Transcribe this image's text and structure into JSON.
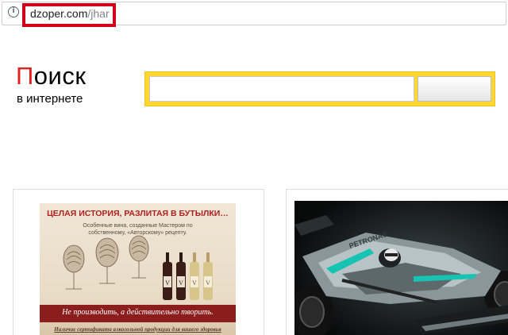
{
  "browser": {
    "url_domain": "dzoper.com",
    "url_path": "/jhar",
    "info_icon": "info-icon"
  },
  "logo": {
    "first_letter": "П",
    "rest": "оиск",
    "subtitle": "в интернете",
    "accent_color": "#e32020"
  },
  "search": {
    "input_value": "",
    "frame_color": "#fdd835"
  },
  "cards": {
    "wine": {
      "headline": "ЦЕЛАЯ ИСТОРИЯ, РАЗЛИТАЯ В БУТЫЛКИ…",
      "subtext": "Особенные вина, созданные Мастером по собственному, «Авторскому» рецепту.",
      "slogan": "Не производить, а действительно творить.",
      "bottom_text": "Наличие сертификата алкогольной продукции для вашего здоровья"
    },
    "f1": {
      "sponsor_text": "PETRONAS"
    }
  }
}
